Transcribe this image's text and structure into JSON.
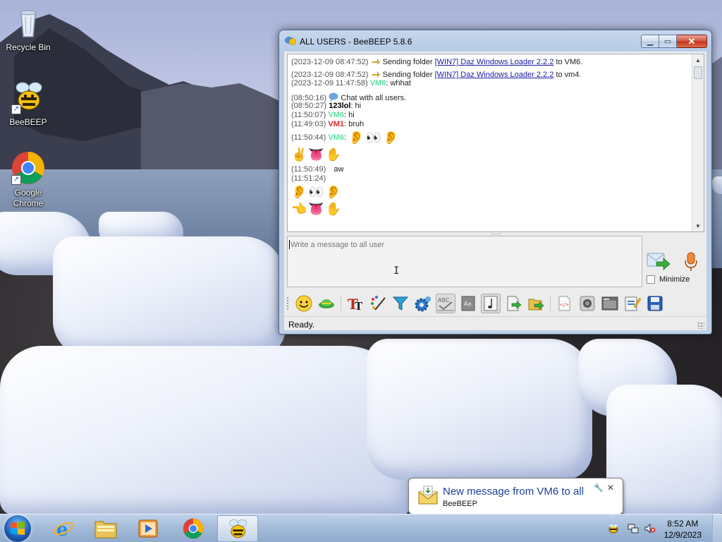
{
  "desktop": {
    "icons": [
      {
        "label": "Recycle Bin",
        "icon": "recycle-bin-icon"
      },
      {
        "label": "BeeBEEP",
        "icon": "beebeep-bee-icon"
      },
      {
        "label": "Google Chrome",
        "icon": "chrome-icon"
      }
    ]
  },
  "window": {
    "title": "ALL USERS - BeeBEEP 5.8.6",
    "controls": {
      "minimize": "minimize-icon",
      "maximize": "maximize-icon",
      "close": "close-icon"
    },
    "chat": {
      "lines": [
        {
          "ts": "(2023-12-09 08:47:52)",
          "pre": " Sending folder ",
          "link": "[WIN7] Daz Windows Loader 2.2.2",
          "post": " to VM6."
        },
        {
          "ts": "(2023-12-09 08:47:52)",
          "pre": " Sending folder ",
          "link": "[WIN7] Daz Windows Loader 2.2.2",
          "post": " to vm4."
        },
        {
          "ts": "(2023-12-09 11:47:58)",
          "user": "VM6",
          "msg": ": whhat"
        },
        {
          "ts": "(08:50:16)",
          "msg": " Chat with all users."
        },
        {
          "ts": "(08:50:27)",
          "user": "123lol",
          "msg": ": hi"
        },
        {
          "ts": "(11:50:07)",
          "user": "VM6",
          "msg": ": hi"
        },
        {
          "ts": "(11:49:03)",
          "user": "VM1",
          "msg": ": bruh"
        },
        {
          "ts": "(11:50:44)",
          "user": "VM6",
          "msg": ":"
        },
        {
          "ts": "(11:50:49)",
          "msg": "aw"
        },
        {
          "ts": "(11:51:24)"
        }
      ],
      "emoji_rows": [
        [
          "👂",
          "👀",
          "👂"
        ],
        [
          "✌",
          "👅",
          "✋"
        ],
        [
          "👂",
          "👀",
          "👂"
        ],
        [
          "👈",
          "👅",
          "✋"
        ]
      ]
    },
    "input": {
      "placeholder": "Write a message to all user"
    },
    "minimize_label": "Minimize",
    "toolbar": [
      "smiley-icon",
      "bee-hat-icon",
      "text-font-icon",
      "color-palette-icon",
      "filter-icon",
      "settings-gear-icon",
      "spellcheck-icon",
      "dictionary-icon",
      "music-note-icon",
      "send-file-icon",
      "send-folder-icon",
      "html-code-icon",
      "webcam-icon",
      "screenshot-icon",
      "edit-notes-icon",
      "save-icon"
    ],
    "status": "Ready."
  },
  "notification": {
    "title": "New message from VM6 to all",
    "subtitle": "BeeBEEP"
  },
  "taskbar": {
    "apps": [
      "internet-explorer-icon",
      "file-explorer-icon",
      "media-player-icon",
      "chrome-icon",
      "beebeep-bee-icon"
    ],
    "clock_time": "8:52 AM",
    "clock_date": "12/9/2023"
  },
  "colors": {
    "vm6": "#5be0a0",
    "vm1": "#d82a2a",
    "link": "#1a1aa6",
    "notification_title": "#1d3f9e"
  }
}
